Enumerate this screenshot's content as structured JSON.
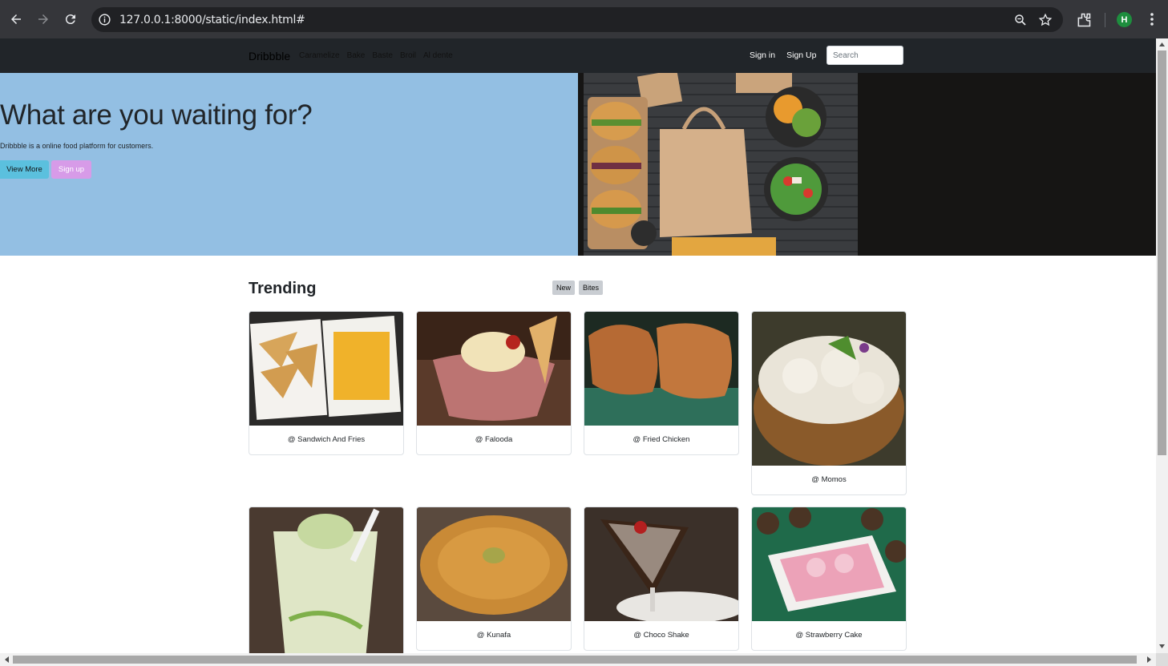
{
  "browser": {
    "url_host": "127.0.0.1",
    "url_rest": ":8000/static/index.html#",
    "profile_initial": "H"
  },
  "site": {
    "brand": "Dribbble",
    "nav_links": [
      "Caramelize",
      "Bake",
      "Baste",
      "Broil",
      "Al dente"
    ],
    "sign_in": "Sign in",
    "sign_up": "Sign Up",
    "search_placeholder": "Search"
  },
  "hero": {
    "title": "What are you waiting for?",
    "subtitle": "Dribbble is a online food platform for customers.",
    "view_more": "View More",
    "sign_up": "Sign up"
  },
  "trending": {
    "heading": "Trending",
    "tags": [
      "New",
      "Bites"
    ],
    "items": [
      {
        "caption": "@ Sandwich And Fries"
      },
      {
        "caption": "@ Falooda"
      },
      {
        "caption": "@ Fried Chicken"
      },
      {
        "caption": "@ Momos"
      },
      {
        "caption": ""
      },
      {
        "caption": "@ Kunafa"
      },
      {
        "caption": "@ Choco Shake"
      },
      {
        "caption": "@ Strawberry Cake"
      }
    ]
  },
  "colors": {
    "hero_bg": "#93bfe3",
    "navbar_bg": "#212529",
    "view_more_btn": "#5bc0de",
    "signup_btn": "#d79be8"
  }
}
